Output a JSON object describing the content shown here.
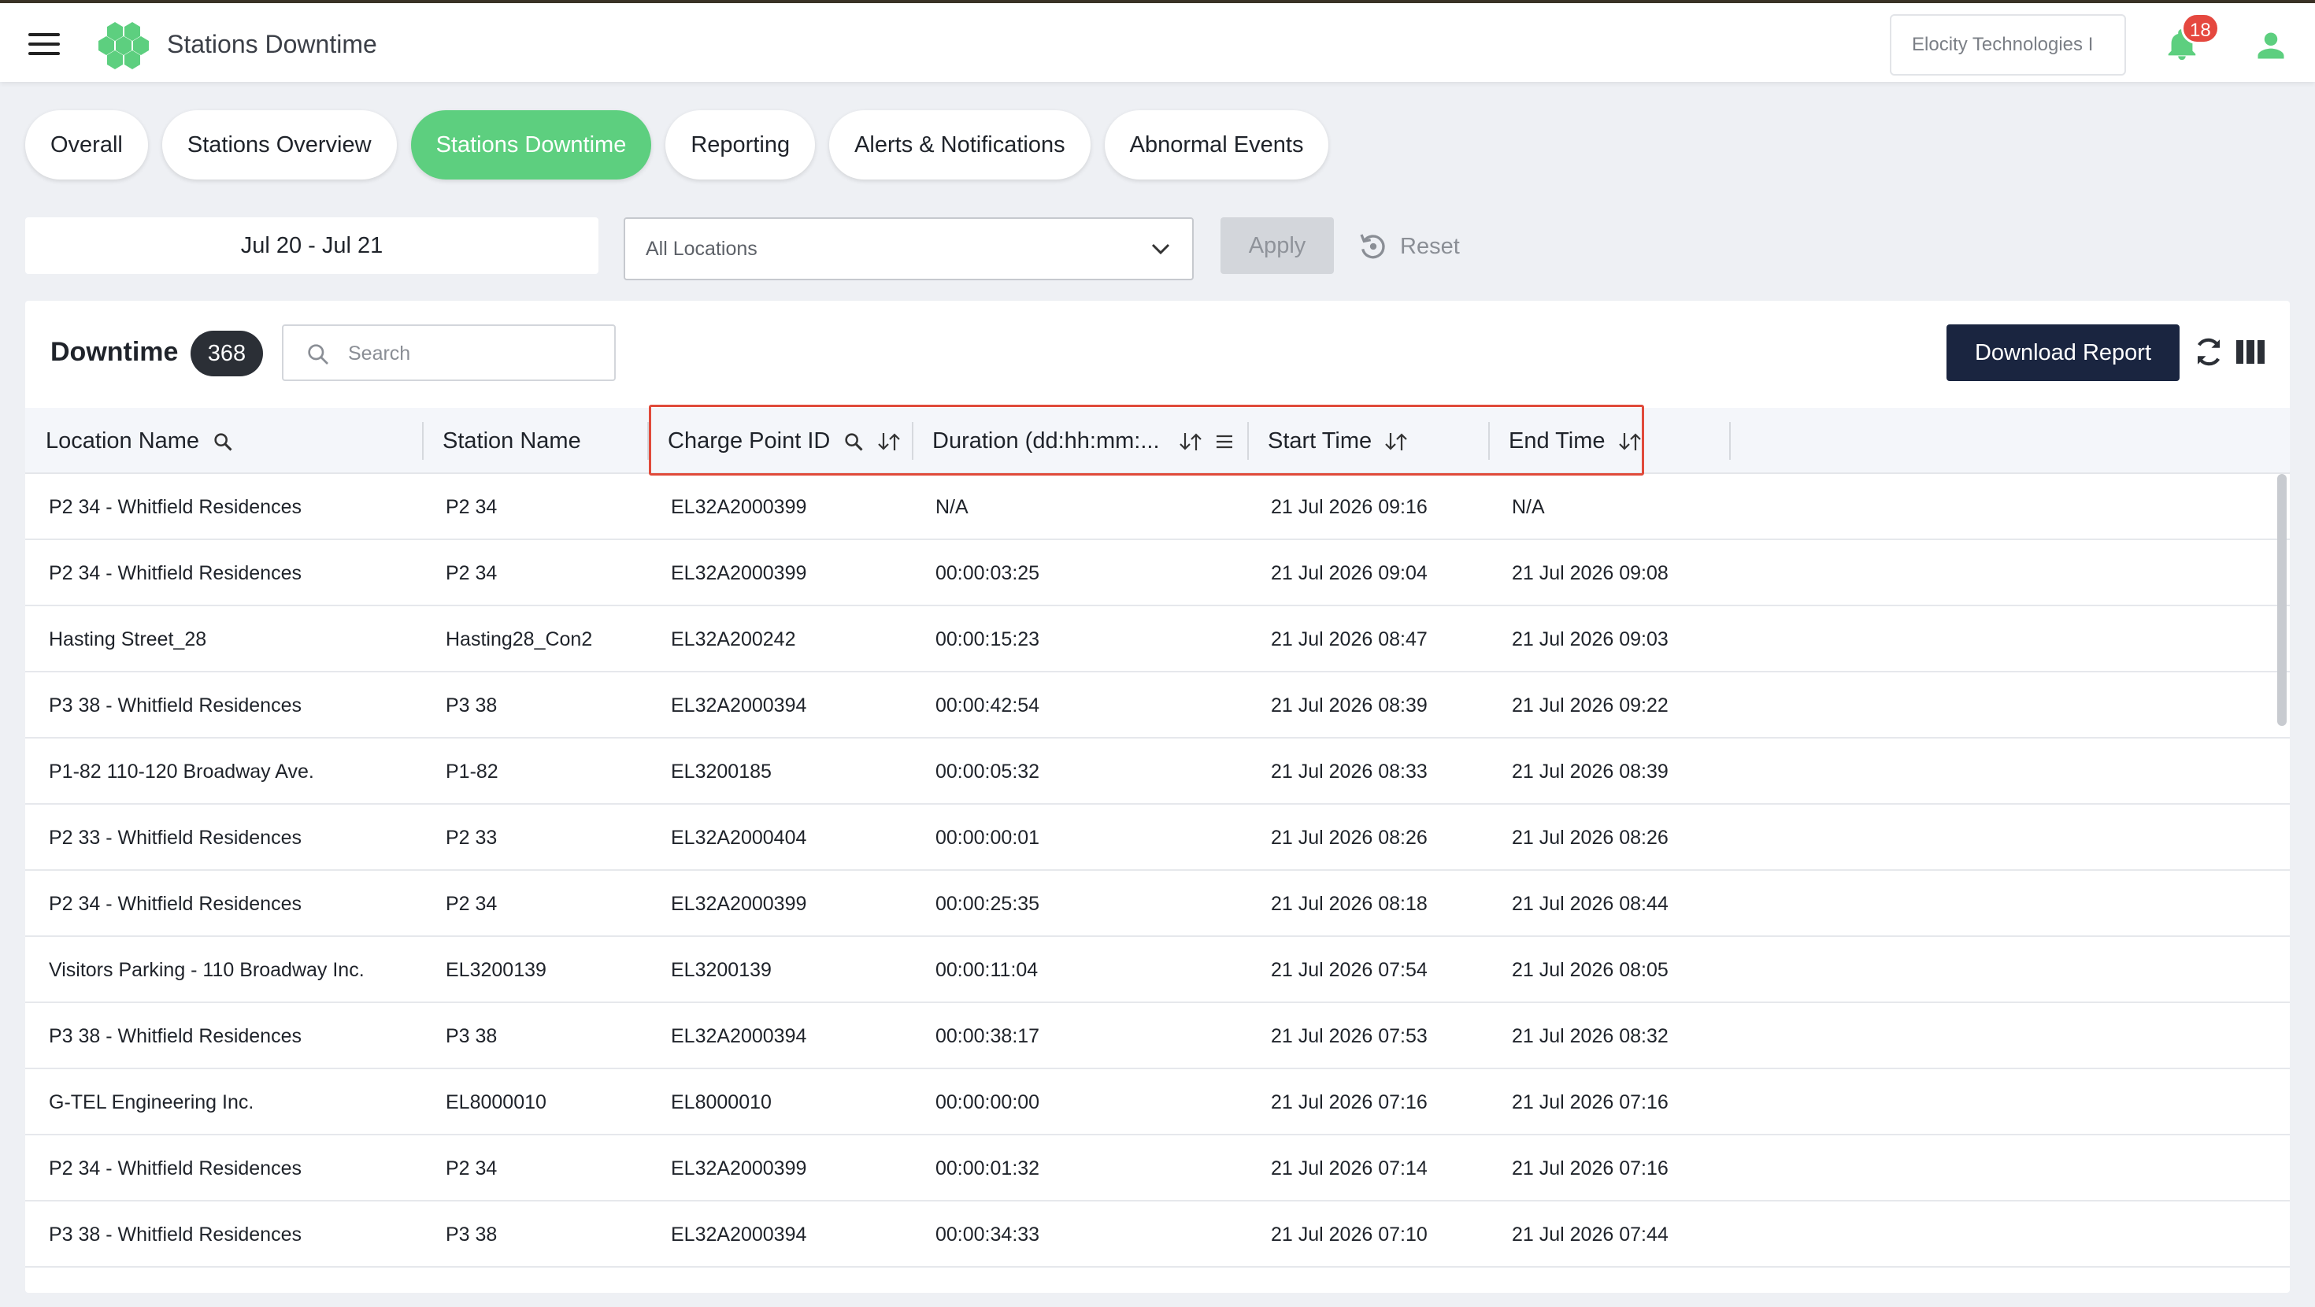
{
  "header": {
    "app_title": "Stations Downtime",
    "organization": "Elocity Technologies I",
    "notification_count": "18",
    "logo_color": "#5dcf7f"
  },
  "tabs": [
    {
      "label": "Overall",
      "active": false
    },
    {
      "label": "Stations Overview",
      "active": false
    },
    {
      "label": "Stations Downtime",
      "active": true
    },
    {
      "label": "Reporting",
      "active": false
    },
    {
      "label": "Alerts & Notifications",
      "active": false
    },
    {
      "label": "Abnormal Events",
      "active": false
    }
  ],
  "filters": {
    "date_range": "Jul 20 - Jul 21",
    "location_select": "All Locations",
    "apply_label": "Apply",
    "reset_label": "Reset"
  },
  "panel": {
    "title": "Downtime",
    "count": "368",
    "search_placeholder": "Search",
    "download_label": "Download Report"
  },
  "table": {
    "columns": [
      {
        "label": "Location Name"
      },
      {
        "label": "Station Name"
      },
      {
        "label": "Charge Point ID"
      },
      {
        "label": "Duration (dd:hh:mm:..."
      },
      {
        "label": "Start Time"
      },
      {
        "label": "End Time"
      }
    ],
    "rows": [
      [
        "P2 34 - Whitfield Residences",
        "P2 34",
        "EL32A2000399",
        "N/A",
        "21 Jul 2026 09:16",
        "N/A"
      ],
      [
        "P2 34 - Whitfield Residences",
        "P2 34",
        "EL32A2000399",
        "00:00:03:25",
        "21 Jul 2026 09:04",
        "21 Jul 2026 09:08"
      ],
      [
        "Hasting Street_28",
        "Hasting28_Con2",
        "EL32A200242",
        "00:00:15:23",
        "21 Jul 2026 08:47",
        "21 Jul 2026 09:03"
      ],
      [
        "P3 38 - Whitfield Residences",
        "P3 38",
        "EL32A2000394",
        "00:00:42:54",
        "21 Jul 2026 08:39",
        "21 Jul 2026 09:22"
      ],
      [
        "P1-82 110-120 Broadway Ave.",
        "P1-82",
        "EL3200185",
        "00:00:05:32",
        "21 Jul 2026 08:33",
        "21 Jul 2026 08:39"
      ],
      [
        "P2 33 - Whitfield Residences",
        "P2 33",
        "EL32A2000404",
        "00:00:00:01",
        "21 Jul 2026 08:26",
        "21 Jul 2026 08:26"
      ],
      [
        "P2 34 - Whitfield Residences",
        "P2 34",
        "EL32A2000399",
        "00:00:25:35",
        "21 Jul 2026 08:18",
        "21 Jul 2026 08:44"
      ],
      [
        "Visitors Parking - 110 Broadway Inc.",
        "EL3200139",
        "EL3200139",
        "00:00:11:04",
        "21 Jul 2026 07:54",
        "21 Jul 2026 08:05"
      ],
      [
        "P3 38 - Whitfield Residences",
        "P3 38",
        "EL32A2000394",
        "00:00:38:17",
        "21 Jul 2026 07:53",
        "21 Jul 2026 08:32"
      ],
      [
        "G-TEL Engineering Inc.",
        "EL8000010",
        "EL8000010",
        "00:00:00:00",
        "21 Jul 2026 07:16",
        "21 Jul 2026 07:16"
      ],
      [
        "P2 34 - Whitfield Residences",
        "P2 34",
        "EL32A2000399",
        "00:00:01:32",
        "21 Jul 2026 07:14",
        "21 Jul 2026 07:16"
      ],
      [
        "P3 38 - Whitfield Residences",
        "P3 38",
        "EL32A2000394",
        "00:00:34:33",
        "21 Jul 2026 07:10",
        "21 Jul 2026 07:44"
      ]
    ]
  }
}
